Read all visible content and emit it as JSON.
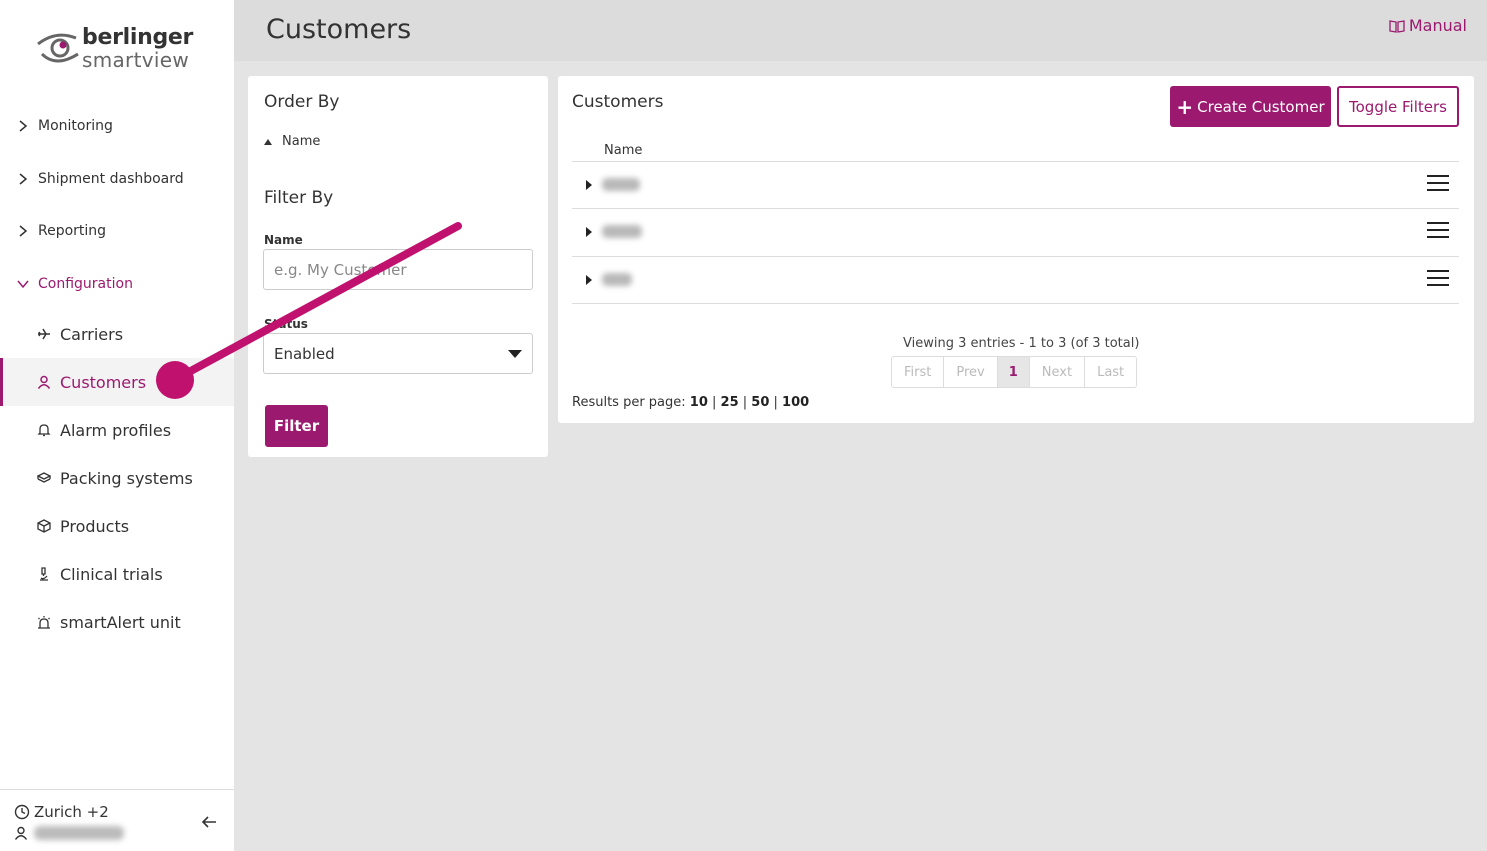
{
  "brand": {
    "line1": "berlinger",
    "line2": "smartview"
  },
  "header": {
    "title": "Customers",
    "manual_label": "Manual"
  },
  "sidebar": {
    "sections": [
      {
        "label": "Monitoring"
      },
      {
        "label": "Shipment dashboard"
      },
      {
        "label": "Reporting"
      },
      {
        "label": "Configuration"
      }
    ],
    "config_items": [
      {
        "label": "Carriers",
        "icon": "airplane-icon"
      },
      {
        "label": "Customers",
        "icon": "user-icon"
      },
      {
        "label": "Alarm profiles",
        "icon": "bell-icon"
      },
      {
        "label": "Packing systems",
        "icon": "box-stack-icon"
      },
      {
        "label": "Products",
        "icon": "cube-icon"
      },
      {
        "label": "Clinical trials",
        "icon": "microscope-icon"
      },
      {
        "label": "smartAlert unit",
        "icon": "siren-icon"
      }
    ],
    "timezone": "Zurich +2"
  },
  "order_panel": {
    "title": "Order By",
    "sort_field": "Name",
    "filter_title": "Filter By",
    "name_label": "Name",
    "name_placeholder": "e.g. My Customer",
    "status_label": "Status",
    "status_value": "Enabled",
    "filter_button": "Filter"
  },
  "customers_panel": {
    "title": "Customers",
    "create_button": "Create Customer",
    "toggle_button": "Toggle Filters",
    "column_name": "Name",
    "rows": 3,
    "viewing": "Viewing 3 entries - 1 to 3 (of 3 total)",
    "pager": {
      "first": "First",
      "prev": "Prev",
      "current": "1",
      "next": "Next",
      "last": "Last"
    },
    "results_label": "Results per page:",
    "page_sizes": [
      "10",
      "25",
      "50",
      "100"
    ]
  },
  "colors": {
    "accent": "#9b1a6f",
    "header_bg": "#dcdcdc",
    "page_bg": "#e4e4e4"
  }
}
